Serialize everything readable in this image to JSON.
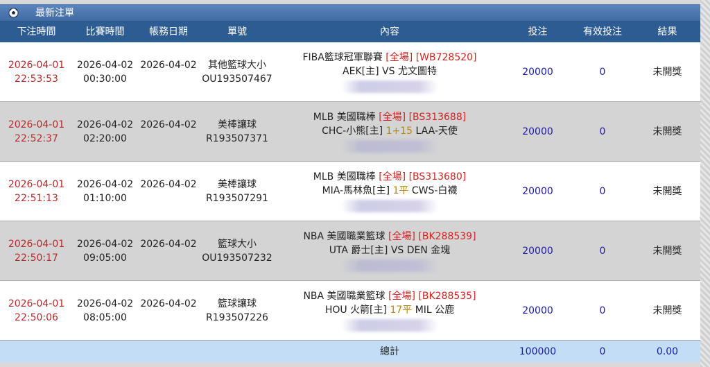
{
  "panel": {
    "title": "最新注單",
    "icon": "soccer-ball-icon"
  },
  "columns": [
    "下注時間",
    "比賽時間",
    "帳務日期",
    "單號",
    "內容",
    "投注",
    "有效投注",
    "結果"
  ],
  "rows": [
    {
      "bet_date": "2026-04-01",
      "bet_time": "22:53:53",
      "match_date": "2026-04-02",
      "match_time": "00:30:00",
      "account_date": "2026-04-02",
      "type": "其他籃球大小",
      "order": "OU193507467",
      "league": "FIBA籃球冠軍聯賽",
      "period": "[全場]",
      "code": "[WB728520]",
      "team_a": "AEK[主]",
      "handicap": "VS",
      "team_b": "尤文圖特",
      "amount": "20000",
      "valid": "0",
      "result": "未開獎"
    },
    {
      "bet_date": "2026-04-01",
      "bet_time": "22:52:37",
      "match_date": "2026-04-02",
      "match_time": "02:20:00",
      "account_date": "2026-04-02",
      "type": "美棒讓球",
      "order": "R193507371",
      "league": "MLB 美國職棒",
      "period": "[全場]",
      "code": "[BS313688]",
      "team_a": "CHC-小熊[主]",
      "handicap": "1+15",
      "team_b": "LAA-天使",
      "amount": "20000",
      "valid": "0",
      "result": "未開獎"
    },
    {
      "bet_date": "2026-04-01",
      "bet_time": "22:51:13",
      "match_date": "2026-04-02",
      "match_time": "01:10:00",
      "account_date": "2026-04-02",
      "type": "美棒讓球",
      "order": "R193507291",
      "league": "MLB 美國職棒",
      "period": "[全場]",
      "code": "[BS313680]",
      "team_a": "MIA-馬林魚[主]",
      "handicap": "1平",
      "team_b": "CWS-白襪",
      "amount": "20000",
      "valid": "0",
      "result": "未開獎"
    },
    {
      "bet_date": "2026-04-01",
      "bet_time": "22:50:17",
      "match_date": "2026-04-02",
      "match_time": "09:05:00",
      "account_date": "2026-04-02",
      "type": "籃球大小",
      "order": "OU193507232",
      "league": "NBA 美國職業籃球",
      "period": "[全場]",
      "code": "[BK288539]",
      "team_a": "UTA 爵士[主]",
      "handicap": "VS",
      "team_b": "DEN 金塊",
      "amount": "20000",
      "valid": "0",
      "result": "未開獎"
    },
    {
      "bet_date": "2026-04-01",
      "bet_time": "22:50:06",
      "match_date": "2026-04-02",
      "match_time": "08:05:00",
      "account_date": "2026-04-02",
      "type": "籃球讓球",
      "order": "R193507226",
      "league": "NBA 美國職業籃球",
      "period": "[全場]",
      "code": "[BK288535]",
      "team_a": "HOU 火箭[主]",
      "handicap": "17平",
      "team_b": "MIL 公鹿",
      "amount": "20000",
      "valid": "0",
      "result": "未開獎"
    }
  ],
  "total": {
    "label": "總計",
    "amount": "100000",
    "valid": "0",
    "result": "0.00"
  }
}
